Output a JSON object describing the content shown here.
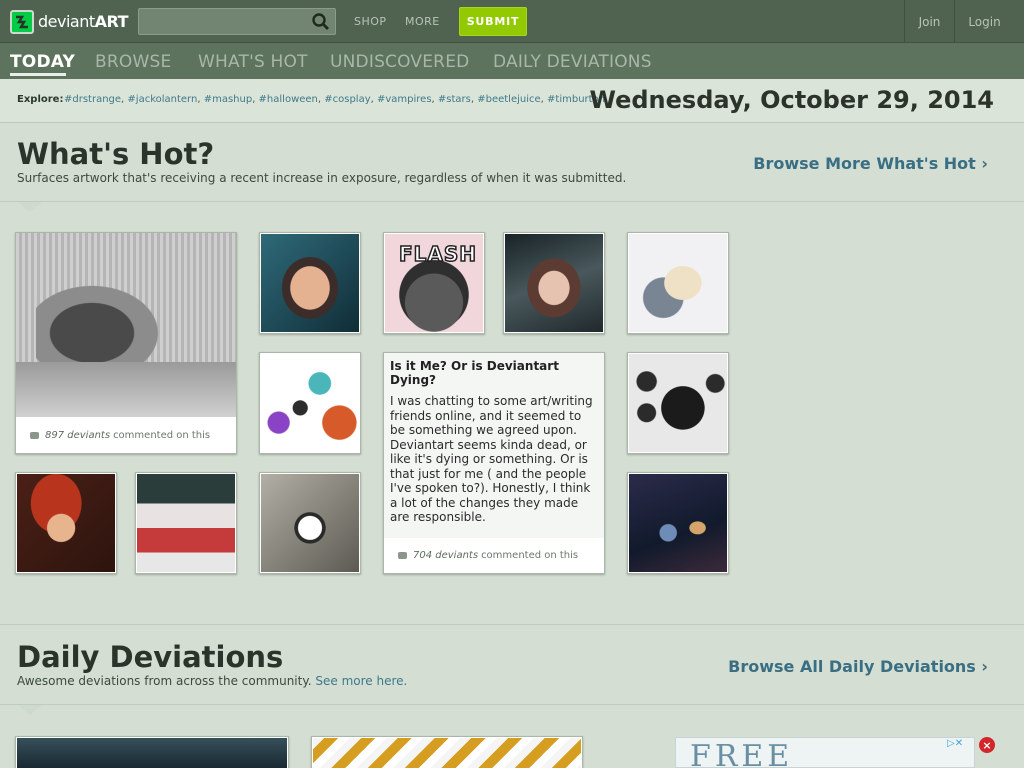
{
  "topbar": {
    "logo_text_light": "deviant",
    "logo_text_bold": "ART",
    "search_placeholder": "",
    "nav": [
      "SHOP",
      "MORE"
    ],
    "submit": "SUBMIT",
    "join": "Join",
    "login": "Login"
  },
  "tabs": [
    "TODAY",
    "BROWSE",
    "WHAT'S HOT",
    "UNDISCOVERED",
    "DAILY DEVIATIONS"
  ],
  "explore": {
    "label": "Explore:",
    "tags": [
      "#drstrange",
      "#jackolantern",
      "#mashup",
      "#halloween",
      "#cosplay",
      "#vampires",
      "#stars",
      "#beetlejuice",
      "#timburton"
    ]
  },
  "date": "Wednesday, October 29, 2014",
  "whats_hot": {
    "title": "What's Hot?",
    "subtitle": "Surfaces artwork that's receiving a recent increase in exposure, regardless of when it was submitted.",
    "more": "Browse More What's Hot"
  },
  "featured": {
    "comments_count": "897 deviants",
    "comments_suffix": "commented on this"
  },
  "journal": {
    "title": "Is it Me? Or is Deviantart Dying?",
    "body": "I was chatting to some art/writing friends online, and it seemed to be something we agreed upon.\nDeviantart seems kinda dead, or like it's dying or something. Or is that just for me ( and the people I've spoken to?). Honestly, I think a lot of the changes they made are responsible.",
    "comments_count": "704 deviants",
    "comments_suffix": "commented on this"
  },
  "thumb_text": {
    "flash": "FLASH"
  },
  "daily": {
    "title": "Daily Deviations",
    "subtitle": "Awesome deviations from across the community.",
    "subtitle_link": "See more here.",
    "more": "Browse All Daily Deviations"
  },
  "ad": {
    "text": "FREE"
  }
}
